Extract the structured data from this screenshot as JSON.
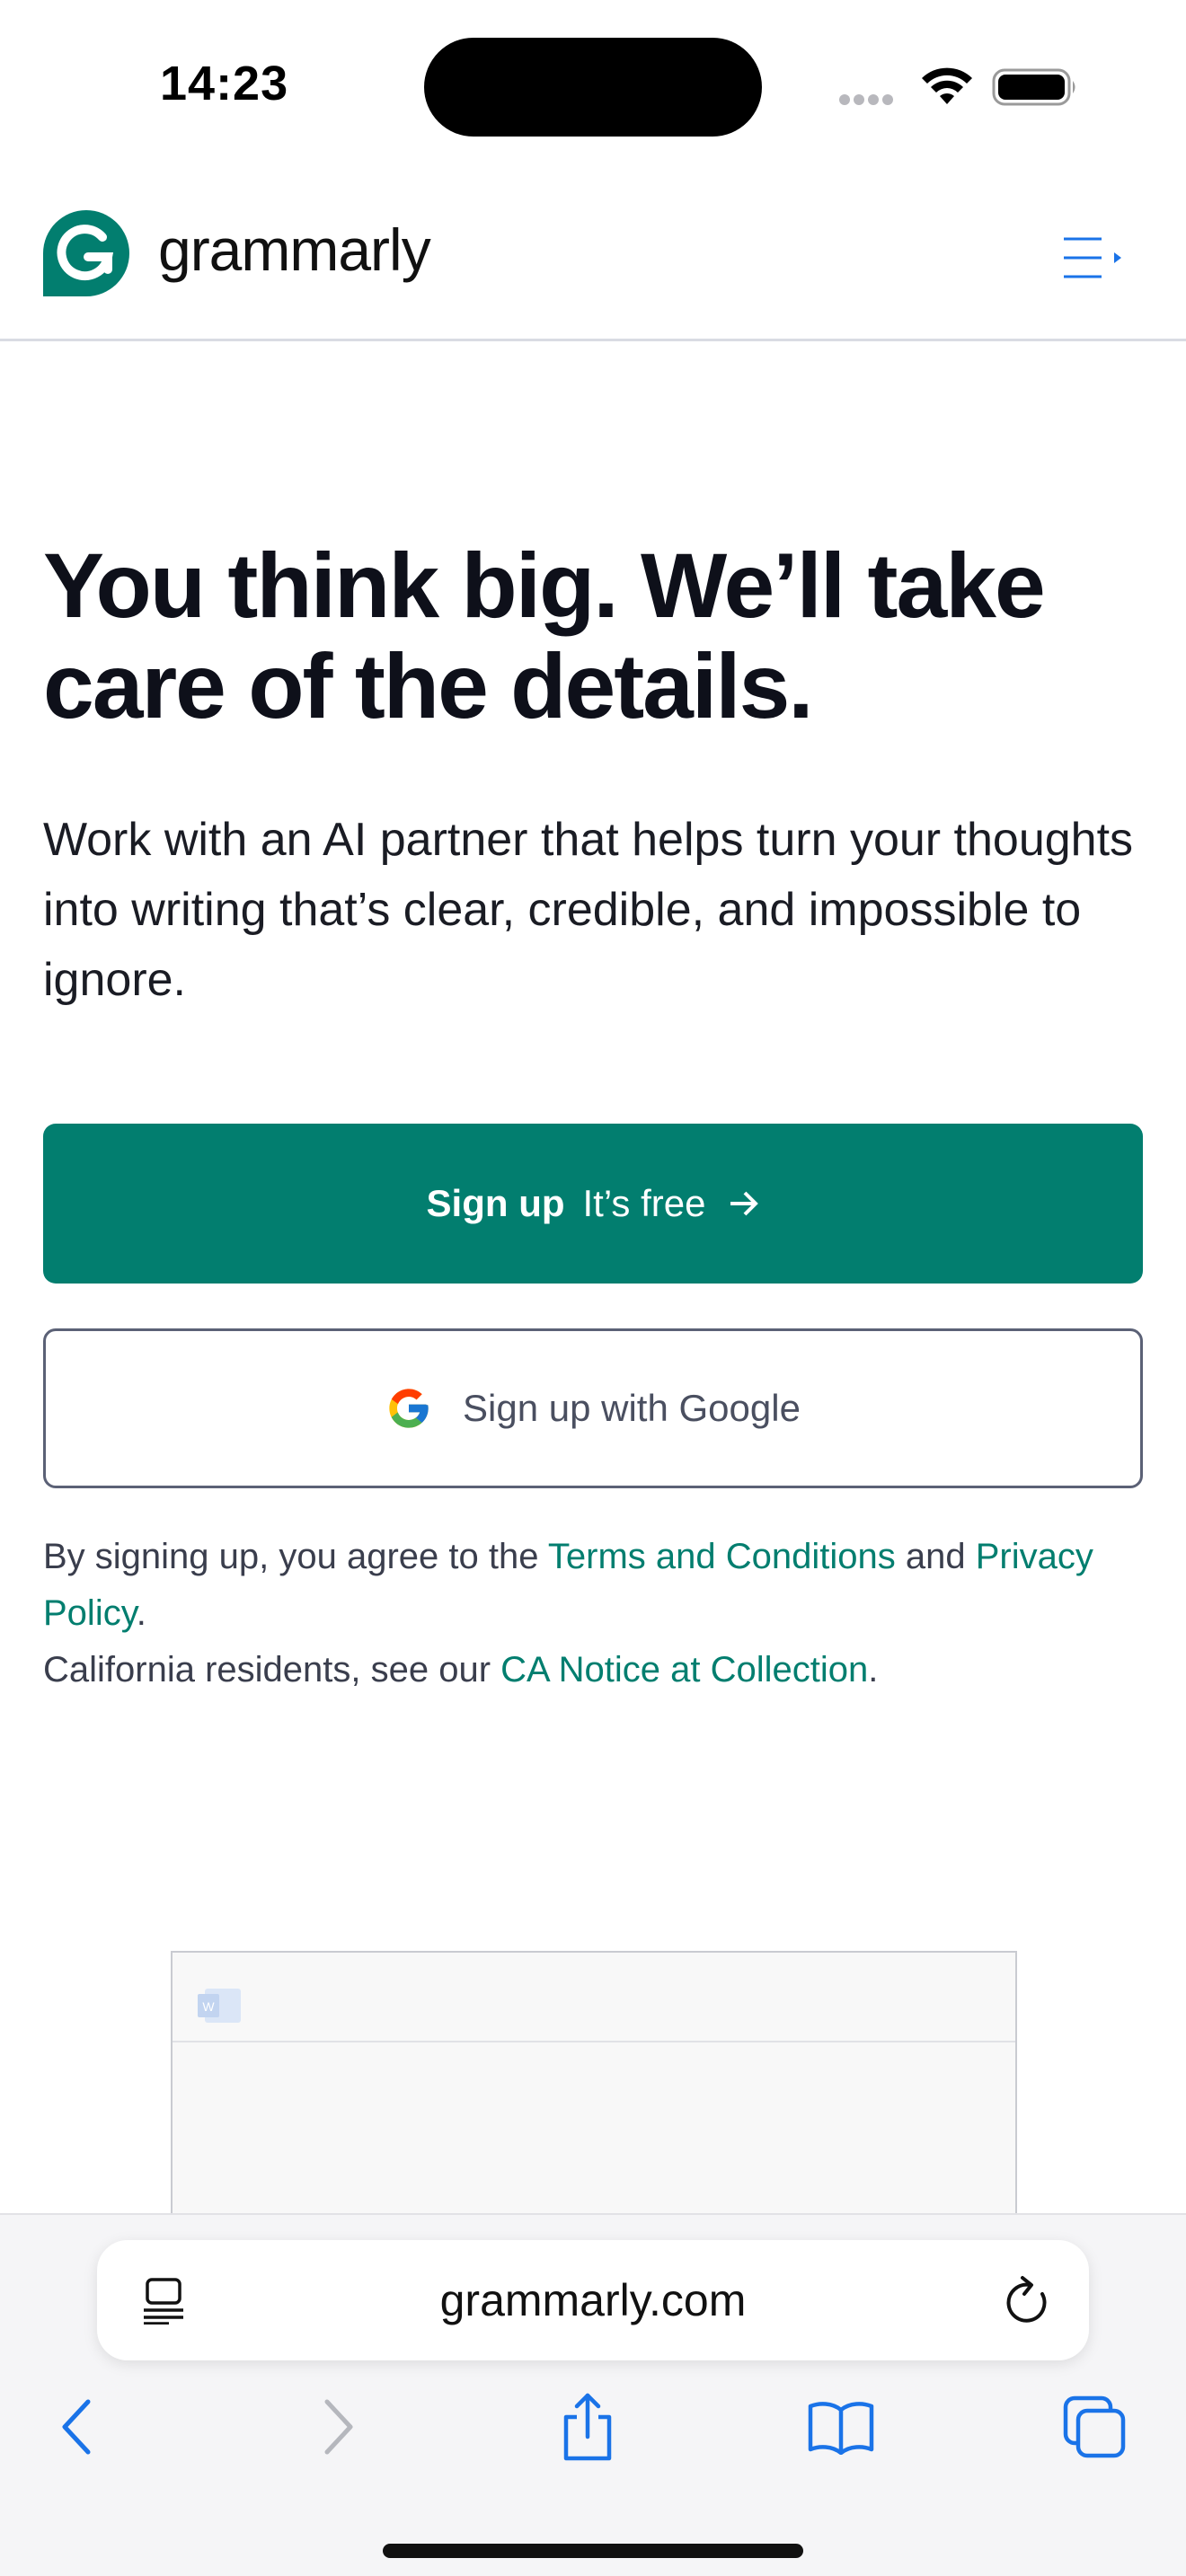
{
  "status_bar": {
    "time": "14:23"
  },
  "header": {
    "brand_name": "grammarly",
    "brand_color": "#027e6f"
  },
  "hero": {
    "title": "You think big. We’ll take care of the details.",
    "subtitle": "Work with an AI partner that helps turn your thoughts into writing that’s clear, credible, and impossible to ignore."
  },
  "signup_button": {
    "strong_label": "Sign up",
    "light_label": "It’s free",
    "color": "#027e6f"
  },
  "google_button": {
    "label": "Sign up with Google"
  },
  "legal": {
    "line1_prefix": "By signing up, you agree to the ",
    "terms_link": "Terms and Conditions",
    "and": " and ",
    "privacy_link": "Privacy Policy",
    "period1": ".",
    "line2_prefix": "California residents, see our ",
    "ca_link": "CA Notice at Collection",
    "period2": "."
  },
  "browser": {
    "url": "grammarly.com",
    "accent": "#1a73e8"
  }
}
